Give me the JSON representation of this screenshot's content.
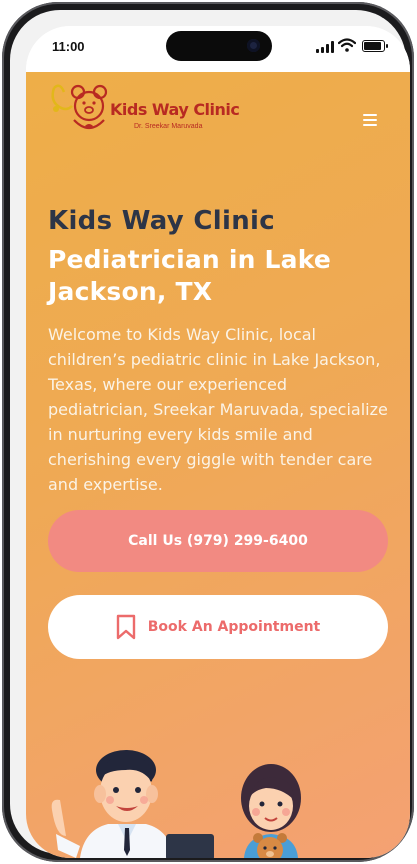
{
  "status_bar": {
    "time": "11:00"
  },
  "header": {
    "logo_title": "Kids Way Clinic",
    "logo_subtitle": "Dr. Sreekar Maruvada",
    "menu_icon": "hamburger-menu-icon"
  },
  "hero": {
    "brand_heading": "Kids Way Clinic",
    "sub_heading": "Pediatrician in Lake Jackson, TX",
    "intro": "Welcome to Kids Way Clinic, local children’s pediatric clinic in Lake Jackson, Texas, where our experienced pediatrician, Sreekar Maruvada, specialize in nurturing every kids smile and cherishing every giggle with tender care and expertise.",
    "call_button": "Call Us (979) 299-6400",
    "book_button": "Book An Appointment",
    "book_icon": "bookmark-icon"
  },
  "colors": {
    "background_start": "#eeae48",
    "background_end": "#f4a173",
    "heading_dark": "#2d3547",
    "call_button": "#f28a82",
    "book_text": "#ec6b6b",
    "logo_red": "#b82a22"
  }
}
